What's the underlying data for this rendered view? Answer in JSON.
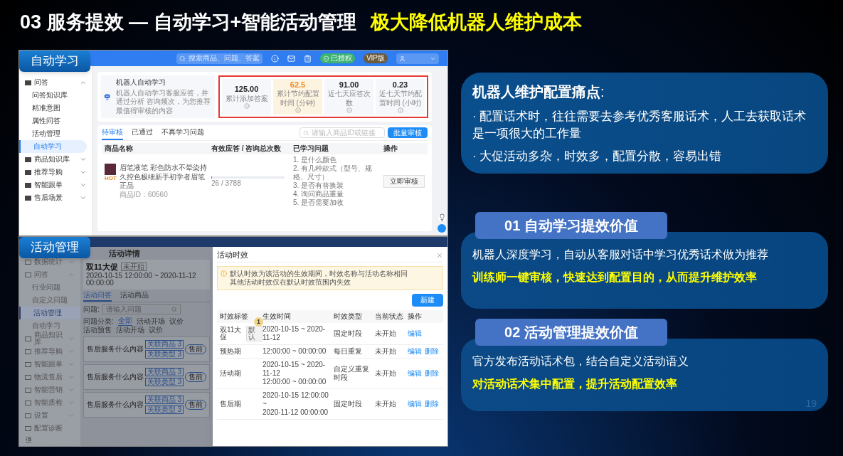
{
  "title": {
    "main": "03  服务提效 — 自动学习+智能活动管理",
    "highlight": "极大降低机器人维护成本"
  },
  "auto_learning_screen": {
    "label": "自动学习",
    "search_placeholder": "搜索商品、问题、答案",
    "badges": [
      {
        "kind": "authorized",
        "text": "已授权"
      },
      {
        "kind": "vip",
        "text": "VIP版"
      }
    ],
    "sidebar": [
      {
        "kind": "group",
        "label": "问答",
        "expanded": true,
        "children": [
          {
            "label": "问答知识库",
            "selected": false
          },
          {
            "label": "精准意图",
            "selected": false
          },
          {
            "label": "属性问答",
            "selected": false
          },
          {
            "label": "活动管理",
            "selected": false
          },
          {
            "label": "自动学习",
            "selected": true
          }
        ]
      },
      {
        "kind": "group",
        "label": "商品知识库",
        "expanded": false
      },
      {
        "kind": "group",
        "label": "推荐导购",
        "expanded": false
      },
      {
        "kind": "group",
        "label": "智能跟单",
        "expanded": false
      },
      {
        "kind": "group",
        "label": "售后场景",
        "expanded": false
      }
    ],
    "intro": {
      "title": "机器人自动学习",
      "description": "机器人自动学习客服应答，并通过分析 咨询频次，为您推荐最值得审核的内容"
    },
    "stats": [
      {
        "value": "125.00",
        "label": "累计添加答案",
        "highlighted": false
      },
      {
        "value": "62.5",
        "label": "累计节约配置时间 (分钟)",
        "highlighted": true
      },
      {
        "value": "91.00",
        "label": "近七天应答次数",
        "highlighted": false
      },
      {
        "value": "0.23",
        "label": "近七天节约配置时间 (小时)",
        "highlighted": false
      }
    ],
    "tabs": [
      {
        "label": "待审核",
        "selected": true
      },
      {
        "label": "已通过",
        "selected": false
      },
      {
        "label": "不再学习问题",
        "selected": false
      }
    ],
    "filter_placeholder": "请输入商品ID或链接",
    "batch_button": "批量审核",
    "columns": [
      "商品名称",
      "有效应答 / 咨询总次数",
      "已学习问题",
      "操作"
    ],
    "rows": [
      {
        "product_name": "眉笔液笔 彩色防水不晕染持久控色极细新手初学者眉笔正品",
        "product_id": "商品ID：60560",
        "tag": "HOT",
        "level": 0.01,
        "reading": "26 / 3788",
        "questions": [
          "1. 是什么颜色",
          "2. 有几种款式（型号、规格、尺寸）",
          "3. 是否有替换装",
          "4. 询问商品重量",
          "5. 是否需要加收"
        ],
        "action": "立即审核"
      }
    ]
  },
  "activity_screen": {
    "label": "活动管理",
    "sidebar": [
      {
        "kind": "group",
        "label": "数据统计",
        "expanded": false
      },
      {
        "kind": "group",
        "label": "问答",
        "expanded": true,
        "children": [
          {
            "label": "行业问题",
            "selected": false
          },
          {
            "label": "自定义问题",
            "selected": false
          },
          {
            "label": "活动管理",
            "selected": true
          },
          {
            "label": "自动学习",
            "selected": false
          }
        ]
      },
      {
        "kind": "group",
        "label": "商品知识库",
        "expanded": false
      },
      {
        "kind": "group",
        "label": "推荐导购",
        "expanded": false
      },
      {
        "kind": "group",
        "label": "智能跟单",
        "expanded": false
      },
      {
        "kind": "group",
        "label": "物流售后",
        "expanded": false
      },
      {
        "kind": "group",
        "label": "智能营销",
        "expanded": false
      },
      {
        "kind": "group",
        "label": "智能质检",
        "expanded": false
      },
      {
        "kind": "group",
        "label": "设置",
        "expanded": false
      },
      {
        "kind": "link",
        "label": "配置诊断"
      }
    ],
    "page_title": "活动详情",
    "activity": {
      "name": "双11大促",
      "status": "未开始",
      "period": "2020-10-15 12:00:00 ~ 2020-11-12 00:00:00"
    },
    "tabs": [
      {
        "label": "活动问答",
        "selected": true
      },
      {
        "label": "活动商品",
        "selected": false
      }
    ],
    "question_label": "问题:",
    "question_placeholder": "请输入问题",
    "category_label": "问题分类:",
    "categories": [
      {
        "label": "全部",
        "selected": true
      },
      {
        "label": "活动开场",
        "selected": false
      },
      {
        "label": "议价",
        "selected": false
      },
      {
        "label": "活动预售",
        "selected": false
      },
      {
        "label": "活动开场",
        "selected": false
      },
      {
        "label": "议价",
        "selected": false
      }
    ],
    "cards": [
      {
        "question": "售后服务什么内容",
        "tags": [
          "关联商品 3",
          "关联类型 3"
        ],
        "badge": "售前"
      },
      {
        "question": "售后服务什么内容",
        "tags": [
          "关联商品 3",
          "关联类型 3"
        ],
        "badge": "售前"
      },
      {
        "question": "售后服务什么内容",
        "tags": [
          "关联商品 3",
          "关联类型 3"
        ],
        "badge": "售前"
      }
    ],
    "modal": {
      "title": "活动时效",
      "notice": [
        "默认时效为该活动的生效期间，时效名称与活动名称相同",
        "其他活动时效仅在默认时效范围内失效"
      ],
      "new_button": "新建",
      "step_marker": "1",
      "columns": [
        "时效标签",
        "生效时间",
        "时效类型",
        "当前状态",
        "操作"
      ],
      "rows": [
        {
          "label": "双11大促",
          "default_tag": "默认",
          "time": [
            "2020-10-15 ~ 2020-11-12"
          ],
          "type": "固定时段",
          "status": "未开始",
          "actions": [
            "编辑"
          ]
        },
        {
          "label": "预热期",
          "time": [
            "12:00:00 ~ 00:00:00"
          ],
          "type": "每日重复",
          "status": "未开始",
          "actions": [
            "编辑",
            "删除"
          ]
        },
        {
          "label": "活动期",
          "time": [
            "2020-10-15 ~ 2020-11-12",
            "12:00:00 ~ 00:00:00"
          ],
          "type": "自定义重复时段",
          "status": "未开始",
          "actions": [
            "编辑",
            "删除"
          ]
        },
        {
          "label": "售后期",
          "time": [
            "2020-10-15 12:00:00 ~",
            "2020-11-12 00:00:00"
          ],
          "type": "固定时段",
          "status": "未开始",
          "actions": [
            "编辑",
            "删除"
          ]
        }
      ]
    }
  },
  "pain_points": {
    "title": "**机器人维护配置痛点**:",
    "bullets": [
      "· 配置话术时，往往需要去参考优秀客服话术，人工去获取话术是一项很大的工作量",
      "· 大促活动多杂，时效多，配置分散，容易出错"
    ]
  },
  "values": [
    {
      "heading": "01 自动学习提效价值",
      "text": "机器人深度学习，自动从客服对话中学习优秀话术做为推荐",
      "highlight": "训练师一键审核，快速达到配置目的，从而提升维护效率"
    },
    {
      "heading": "02 活动管理提效价值",
      "text": "官方发布活动话术包，结合自定义活动语义",
      "highlight": "对活动话术集中配置，提升活动配置效率"
    }
  ],
  "page_number": "19"
}
